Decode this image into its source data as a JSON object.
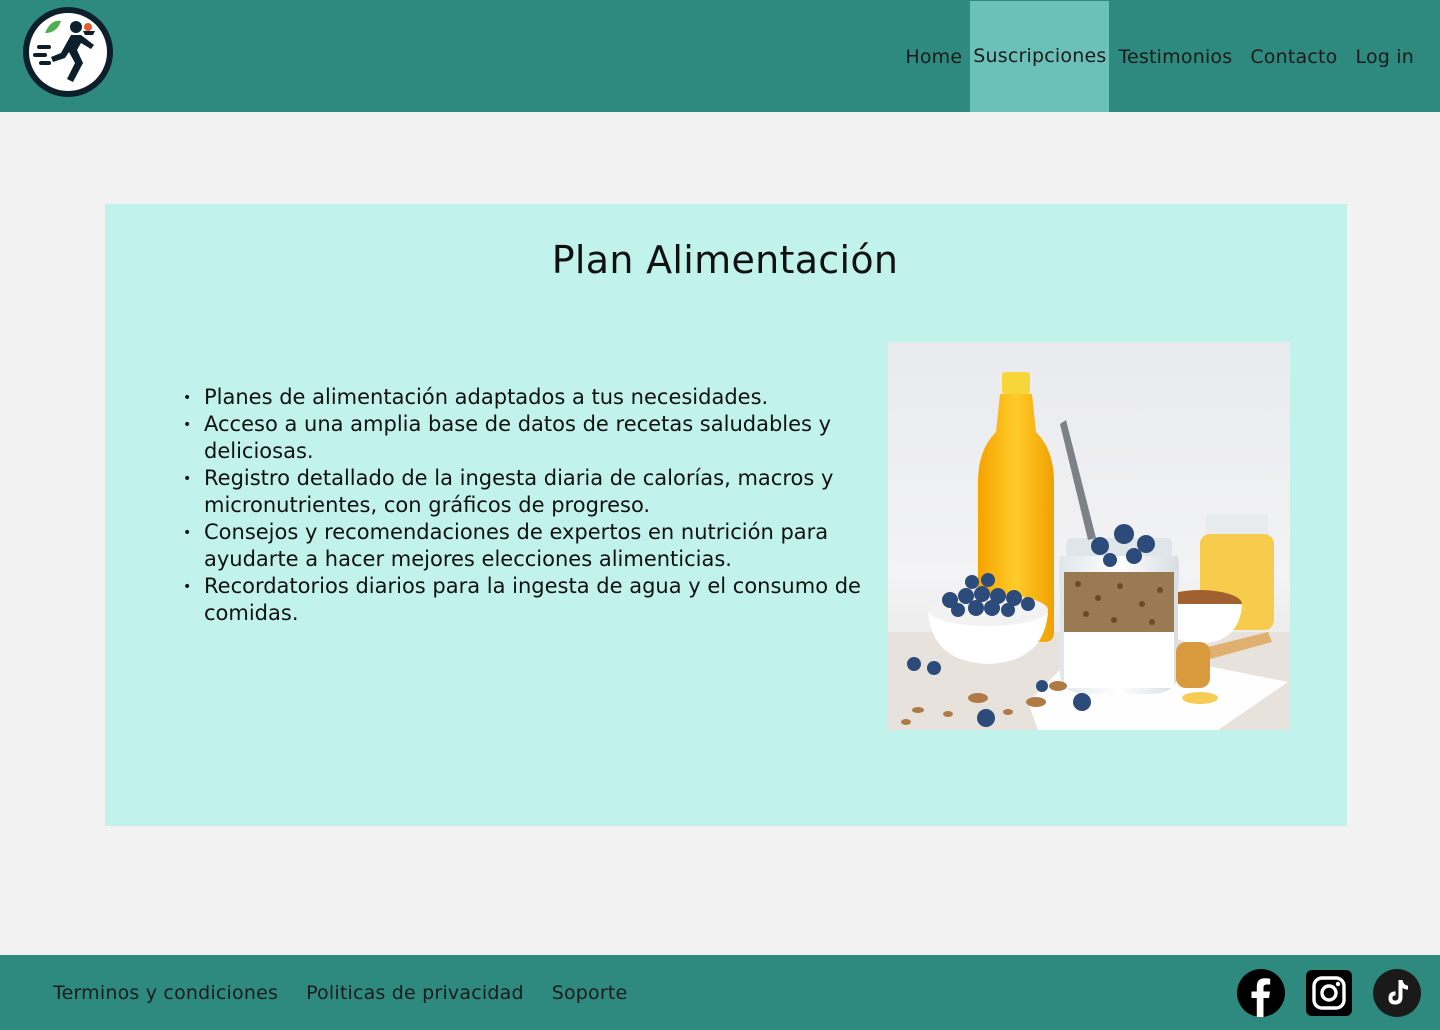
{
  "header": {
    "logo_icon": "runner-with-fruit-logo",
    "nav": [
      {
        "label": "Home",
        "active": false
      },
      {
        "label": "Suscripciones",
        "active": true
      },
      {
        "label": "Testimonios",
        "active": false
      },
      {
        "label": "Contacto",
        "active": false
      },
      {
        "label": "Log in",
        "active": false
      }
    ]
  },
  "plan": {
    "title": "Plan Alimentación",
    "features": [
      "Planes de alimentación adaptados a tus necesidades.",
      "Acceso a una amplia base de datos de recetas saludables y deliciosas.",
      "Registro detallado de la ingesta diaria de calorías, macros y micronutrientes, con gráficos de progreso.",
      "Consejos y recomendaciones de expertos en nutrición para ayudarte a hacer mejores elecciones alimenticias.",
      "Recordatorios diarios para la ingesta de agua y el consumo de comidas."
    ],
    "image_icon": "yogurt-granola-blueberries-juice-photo"
  },
  "footer": {
    "links": [
      "Terminos y condiciones",
      "Politicas de privacidad",
      "Soporte"
    ],
    "social": [
      "facebook-icon",
      "instagram-icon",
      "tiktok-icon"
    ]
  },
  "colors": {
    "header_bg": "#2e8a7f",
    "nav_active_bg": "#6bc0b8",
    "card_bg": "#c2f2ec",
    "page_bg": "#f2f2f2"
  }
}
